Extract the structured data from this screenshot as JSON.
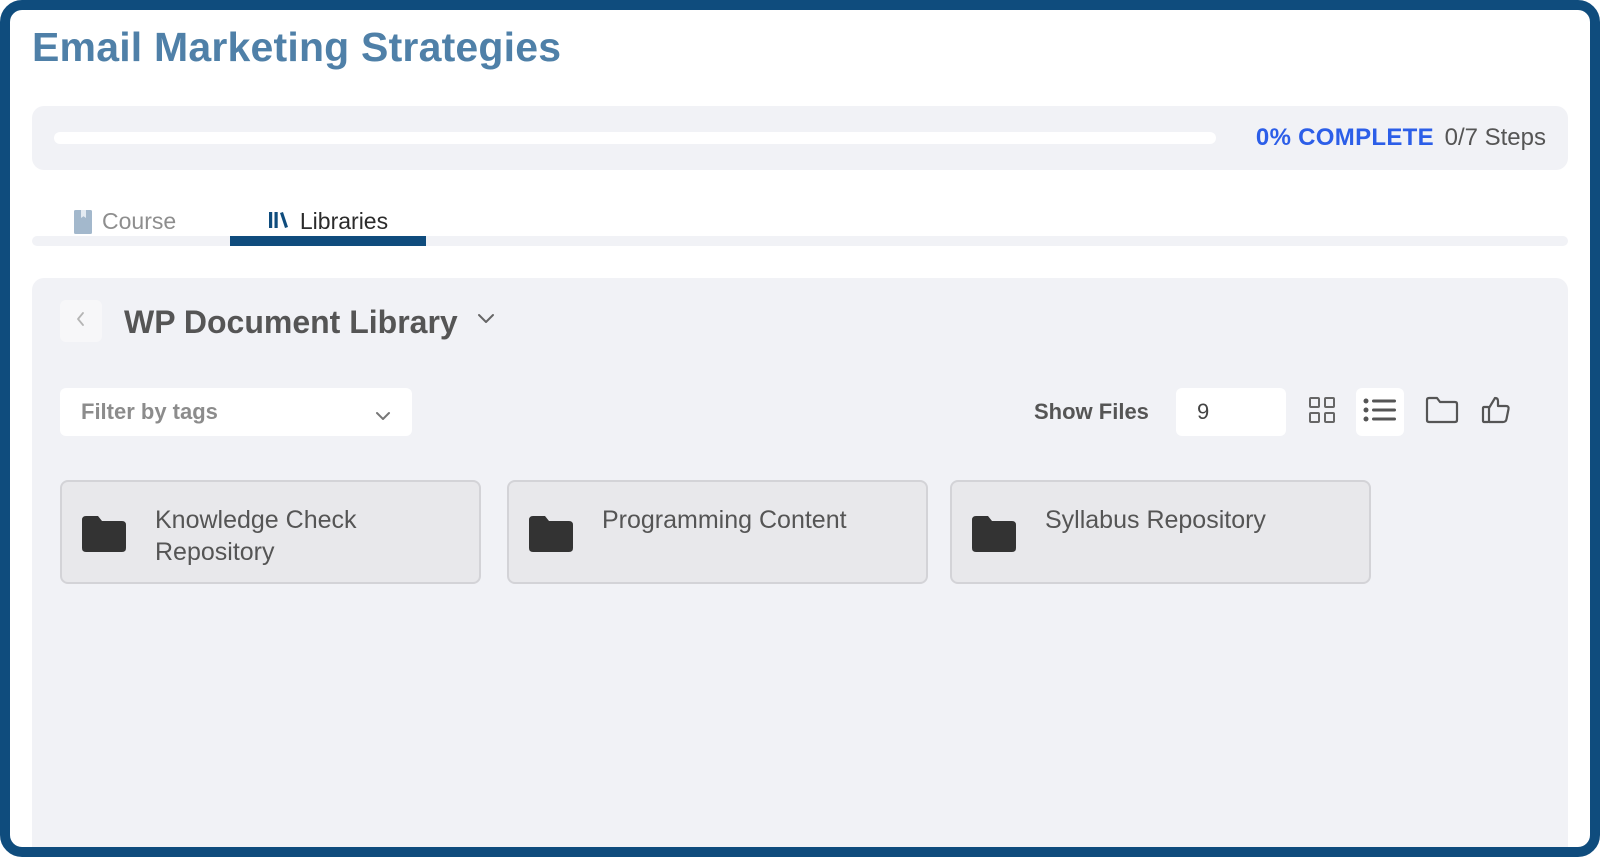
{
  "course": {
    "title": "Email Marketing Strategies"
  },
  "progress": {
    "percent_label": "0% COMPLETE",
    "steps_label": "0/7 Steps",
    "percent": 0
  },
  "tabs": [
    {
      "label": "Course",
      "icon": "book-icon",
      "active": false
    },
    {
      "label": "Libraries",
      "icon": "library-icon",
      "active": true
    }
  ],
  "library": {
    "title": "WP Document Library",
    "filter_placeholder": "Filter by tags",
    "show_files_label": "Show Files",
    "show_files_value": "9",
    "view_buttons": [
      "grid-view-icon",
      "list-view-icon",
      "folder-view-icon",
      "thumbs-up-icon"
    ],
    "folders": [
      {
        "name": "Knowledge Check Repository"
      },
      {
        "name": "Programming Content"
      },
      {
        "name": "Syllabus Repository"
      }
    ]
  },
  "colors": {
    "frame": "#0f4c7d",
    "title": "#4f80a8",
    "accent": "#2c5ee8",
    "panel": "#f1f2f6"
  }
}
